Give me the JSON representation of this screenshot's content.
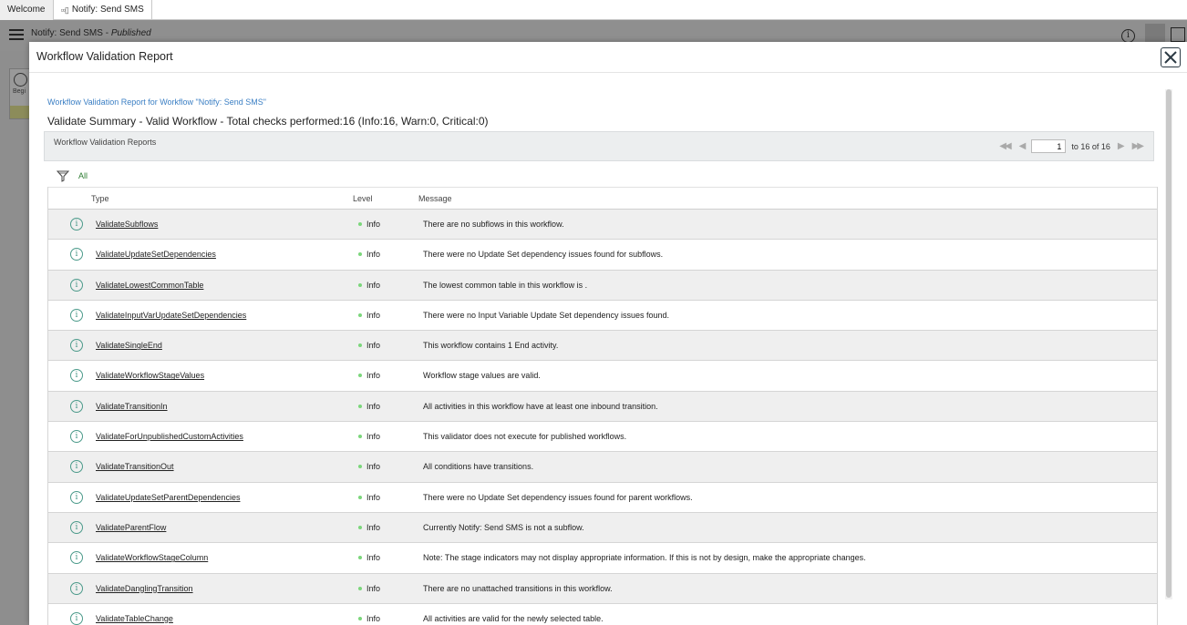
{
  "tabs": [
    {
      "label": "Welcome"
    },
    {
      "label": "Notify: Send SMS",
      "icon": "workflow-icon"
    }
  ],
  "app": {
    "title": "Notify: Send SMS - ",
    "status": "Published",
    "palette_label": "Begi"
  },
  "modal": {
    "title": "Workflow Validation Report",
    "report_link": "Workflow Validation Report for Workflow \"Notify: Send SMS\"",
    "summary": "Validate Summary - Valid Workflow - Total checks performed:16 (Info:16, Warn:0, Critical:0)",
    "list_title": "Workflow Validation Reports",
    "pager": {
      "current": "1",
      "total_label": "to 16 of 16"
    },
    "filter_label": "All",
    "columns": {
      "type": "Type",
      "level": "Level",
      "message": "Message"
    },
    "rows": [
      {
        "type": "ValidateSubflows",
        "level": "Info",
        "message": "There are no subflows in this workflow."
      },
      {
        "type": "ValidateUpdateSetDependencies",
        "level": "Info",
        "message": "There were no Update Set dependency issues found for subflows."
      },
      {
        "type": "ValidateLowestCommonTable",
        "level": "Info",
        "message": "The lowest common table in this workflow is ."
      },
      {
        "type": "ValidateInputVarUpdateSetDependencies",
        "level": "Info",
        "message": "There were no Input Variable Update Set dependency issues found."
      },
      {
        "type": "ValidateSingleEnd",
        "level": "Info",
        "message": "This workflow contains 1 End activity."
      },
      {
        "type": "ValidateWorkflowStageValues",
        "level": "Info",
        "message": "Workflow stage values are valid."
      },
      {
        "type": "ValidateTransitionIn",
        "level": "Info",
        "message": "All activities in this workflow have at least one inbound transition."
      },
      {
        "type": "ValidateForUnpublishedCustomActivities",
        "level": "Info",
        "message": "This validator does not execute for published workflows."
      },
      {
        "type": "ValidateTransitionOut",
        "level": "Info",
        "message": "All conditions have transitions."
      },
      {
        "type": "ValidateUpdateSetParentDependencies",
        "level": "Info",
        "message": "There were no Update Set dependency issues found for parent workflows."
      },
      {
        "type": "ValidateParentFlow",
        "level": "Info",
        "message": "Currently Notify: Send SMS is not a subflow."
      },
      {
        "type": "ValidateWorkflowStageColumn",
        "level": "Info",
        "message": "Note: The stage indicators may not display appropriate information. If this is not by design, make the appropriate changes."
      },
      {
        "type": "ValidateDanglingTransition",
        "level": "Info",
        "message": "There are no unattached transitions in this workflow."
      },
      {
        "type": "ValidateTableChange",
        "level": "Info",
        "message": "All activities are valid for the newly selected table."
      }
    ]
  },
  "colors": {
    "link": "#3b7fc4",
    "info_icon": "#4b9a8a",
    "level_dot": "#7bd67b",
    "filter": "#2e7d32"
  }
}
